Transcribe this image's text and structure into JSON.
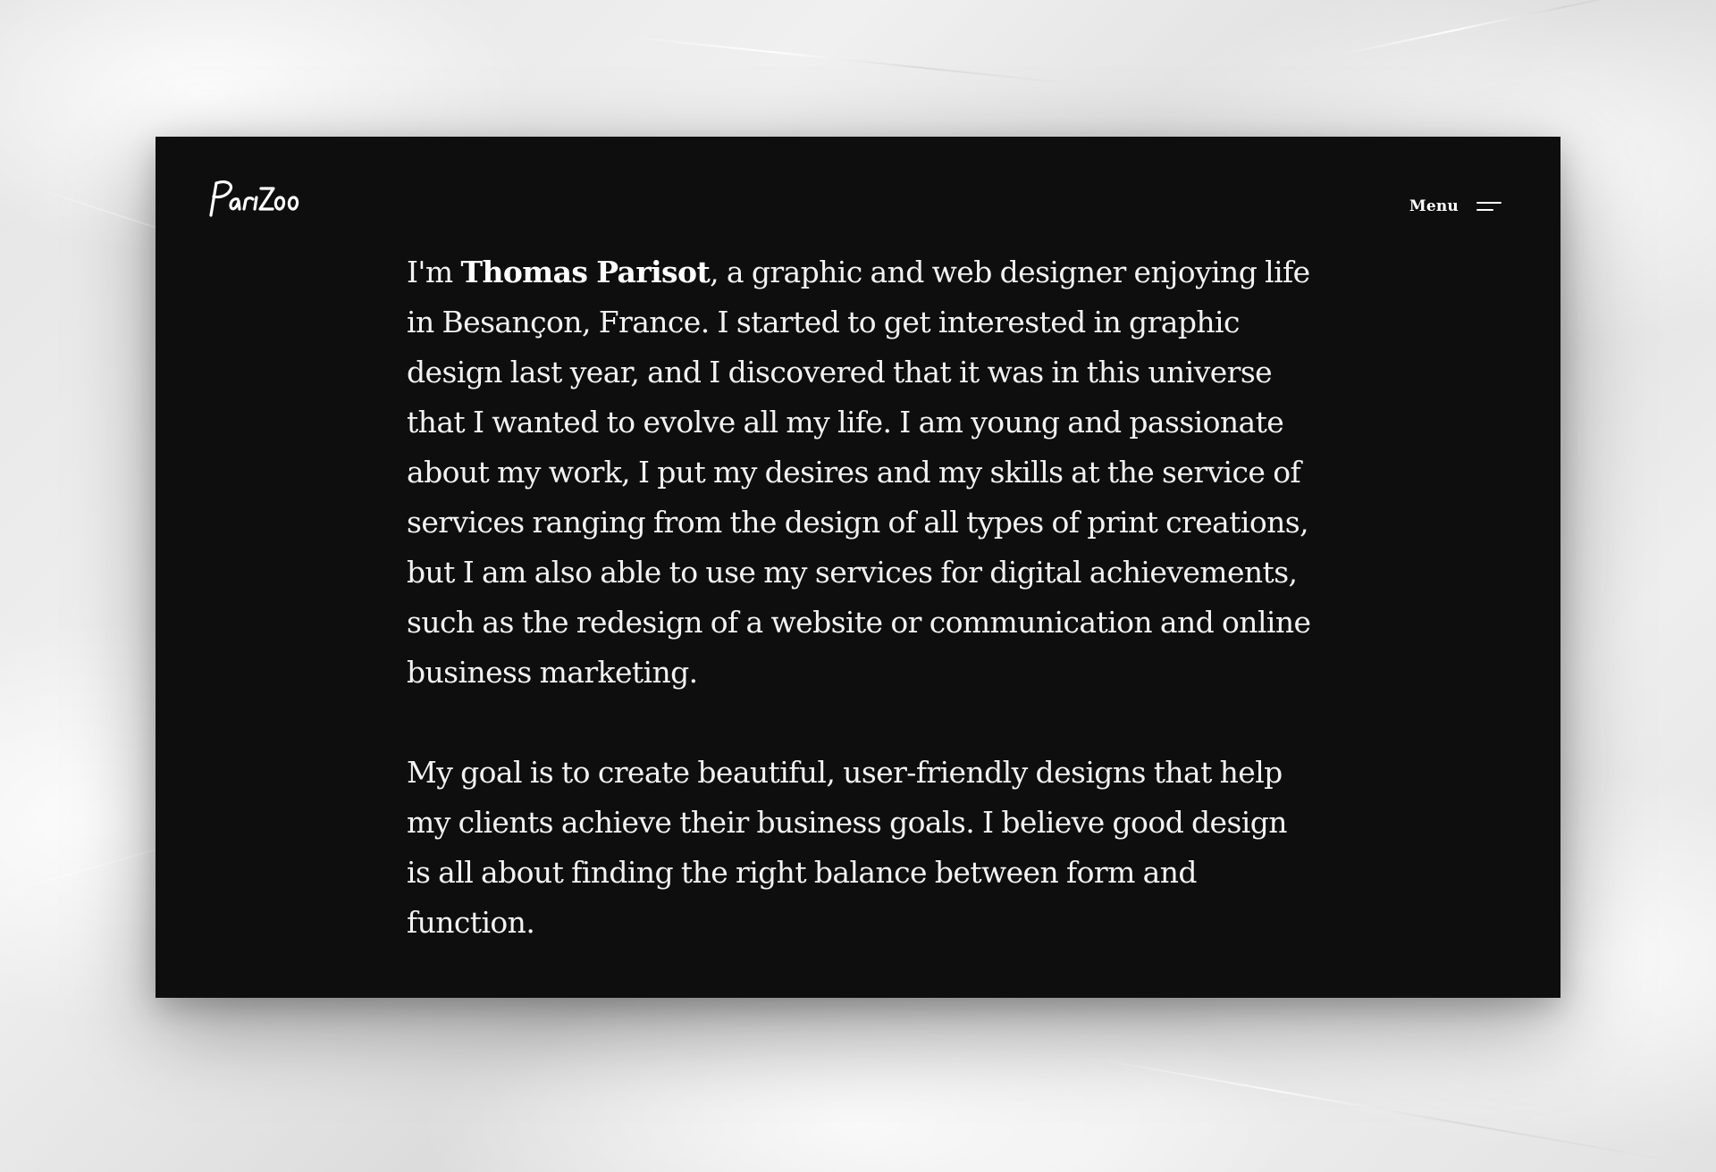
{
  "brand": {
    "logo_text": "Parizoo"
  },
  "nav": {
    "menu_label": "Menu"
  },
  "about": {
    "intro_prefix": "I'm ",
    "name": "Thomas Parisot",
    "intro_rest": ", a graphic and web designer enjoying life in Besançon, France. I started to get interested in graphic design last year, and I discovered that it was in this universe that I wanted to evolve all my life. I am young and passionate about my work, I put my desires and my skills at the service of services ranging from the design of all types of print creations, but I am also able to use my services for digital achievements, such as the redesign of a website or communication and online business marketing.",
    "goal": "My goal is to create beautiful, user-friendly designs that help my clients achieve their business goals. I believe good design is all about finding the right balance between form and function."
  },
  "colors": {
    "card_background": "#0e0e0e",
    "text": "#f2f2f2",
    "page_background": "#e8e8e8"
  },
  "icons": {
    "menu": "hamburger-icon"
  }
}
